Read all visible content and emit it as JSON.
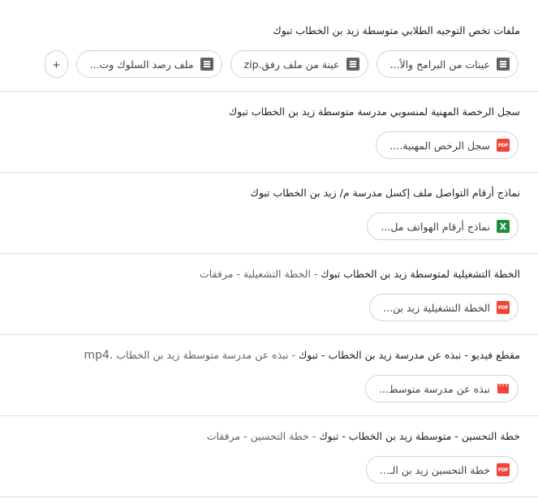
{
  "items": [
    {
      "title_main": "ملفات تخص التوجيه الطلابي متوسطة زيد بن الخطاب تبوك",
      "title_sub": "",
      "title_ext": "",
      "chips": [
        {
          "icon": "doc",
          "label": "عينات من البرامج والأ..."
        },
        {
          "icon": "doc",
          "label": "عينة من ملف رفق.zip"
        },
        {
          "icon": "doc",
          "label": "ملف رصد السلوك وت..."
        }
      ],
      "more_label": "+"
    },
    {
      "title_main": "سجل الرخصة المهنية لمنسوبي مدرسة متوسطة زيد بن الخطاب تبوك",
      "title_sub": "",
      "title_ext": "",
      "chips": [
        {
          "icon": "pdf",
          "label": "سجل الرخص المهنية...."
        }
      ]
    },
    {
      "title_main": "نماذج أرقام التواصل ملف إكسل مدرسة م/ زيد بن الخطاب تبوك",
      "title_sub": "",
      "title_ext": "",
      "chips": [
        {
          "icon": "xls",
          "label": "نماذج أرقام الهواتف مل..."
        }
      ]
    },
    {
      "title_main": "الخطة التشغيلية لمتوسطة زيد بن الخطاب تبوك",
      "title_sub": " - الخطة التشغيلية - مرفقات",
      "title_ext": "",
      "chips": [
        {
          "icon": "pdf",
          "label": "الخطة التشغيلية زيد بن..."
        }
      ]
    },
    {
      "title_main": "مقطع فيديو - نبذه عن مدرسة زيد بن الخطاب - تبوك",
      "title_sub": " - نبذه عن مدرسة متوسطة زيد بن الخطاب ",
      "title_ext": ".mp4",
      "chips": [
        {
          "icon": "vid",
          "label": "نبذه عن مدرسة متوسط..."
        }
      ]
    },
    {
      "title_main": "خطة التحسين - متوسطة زيد بن الخطاب - تبوك",
      "title_sub": " - خطة التحسين - مرفقات",
      "title_ext": "",
      "chips": [
        {
          "icon": "pdf",
          "label": "خطة التحسين زيد بن الـ..."
        }
      ]
    }
  ],
  "icons": {
    "doc": {
      "name": "document-icon",
      "color": "#5f6368"
    },
    "pdf": {
      "name": "pdf-icon",
      "color": "#f44336",
      "text": "PDF"
    },
    "xls": {
      "name": "excel-icon",
      "color": "#1e8e3e",
      "text": "X"
    },
    "vid": {
      "name": "video-icon",
      "color": "#f44336"
    }
  }
}
